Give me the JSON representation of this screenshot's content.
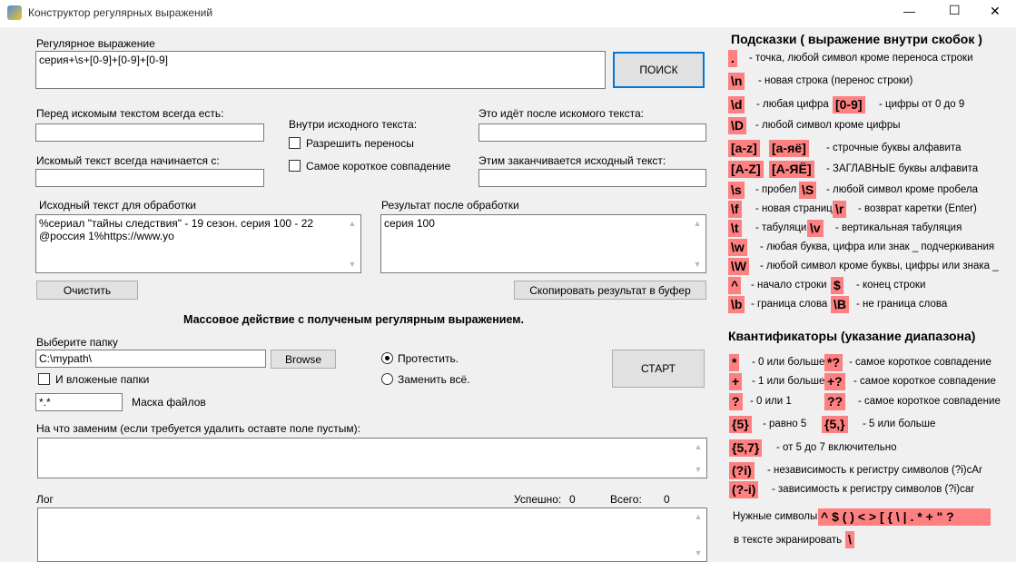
{
  "window": {
    "title": "Конструктор регулярных выражений",
    "min": "—",
    "max": "☐",
    "close": "✕"
  },
  "regex": {
    "label": "Регулярное выражение",
    "value": "серия+\\s+[0-9]+[0-9]+[0-9]",
    "search_button": "ПОИСК"
  },
  "before": {
    "label": "Перед искомым текстом всегда есть:",
    "value": ""
  },
  "starts": {
    "label": "Искомый текст всегда начинается с:",
    "value": ""
  },
  "inside": {
    "label": "Внутри исходного текста:",
    "allow_wrap": "Разрешить переносы",
    "shortest": "Самое короткое совпадение"
  },
  "after": {
    "label": "Это идёт после искомого текста:",
    "value": ""
  },
  "ends": {
    "label": "Этим заканчивается исходный текст:",
    "value": ""
  },
  "source": {
    "label": "Исходный текст для обработки",
    "value": "%сериал \"тайны следствия\" - 19 сезон. серия 100 - 22 @россия 1%https://www.yo",
    "clear_button": "Очистить"
  },
  "result": {
    "label": "Результат после обработки",
    "value": "серия 100",
    "copy_button": "Скопировать результат в буфер"
  },
  "mass": {
    "title": "Массовое действие с полученым регулярным выражением.",
    "folder_label": "Выберите папку",
    "folder_value": "C:\\mypath\\",
    "browse": "Browse",
    "subfolders": "И вложеные папки",
    "mask_value": "*.*",
    "mask_label": "Маска файлов",
    "test": "Протестить.",
    "replace_all": "Заменить всё.",
    "start": "СТАРТ",
    "replace_label": "На что заменим (если требуется удалить оставте поле пустым):",
    "log_label": "Лог",
    "success_label": "Успешно:",
    "success_value": "0",
    "total_label": "Всего:",
    "total_value": "0"
  },
  "hints": {
    "title": "Подсказки ( выражение внутри скобок )",
    "rows": [
      [
        ".",
        "- точка, любой символ кроме переноса строки"
      ],
      [
        "\\n",
        "- новая строка (перенос строки)"
      ],
      [
        "\\d",
        "- любая цифра",
        "[0-9]",
        "- цифры от 0 до 9"
      ],
      [
        "\\D",
        "- любой символ кроме цифры"
      ],
      [
        "[a-z]",
        "[а-яё]",
        "- строчные буквы алфавита"
      ],
      [
        "[A-Z]",
        "[А-ЯЁ]",
        "- ЗАГЛАВНЫЕ буквы алфавита"
      ],
      [
        "\\s",
        "- пробел",
        "\\S",
        "- любой символ кроме пробела"
      ],
      [
        "\\f",
        "- новая страница",
        "\\r",
        "- возврат каретки (Enter)"
      ],
      [
        "\\t",
        "- табуляция",
        "\\v",
        "- вертикальная табуляция"
      ],
      [
        "\\w",
        "- любая буква, цифра или знак _ подчеркивания"
      ],
      [
        "\\W",
        "- любой символ кроме буквы, цифры или знака _"
      ],
      [
        "^",
        "- начало строки",
        "$",
        "- конец строки"
      ],
      [
        "\\b",
        "- граница слова",
        "\\B",
        "- не граница слова"
      ]
    ],
    "quant_title": "Квантификаторы (указание диапазона)",
    "quant": [
      [
        "*",
        "- 0 или больше",
        "*?",
        "- самое короткое совпадение"
      ],
      [
        "+",
        "- 1 или больше",
        "+?",
        "- самое короткое совпадение"
      ],
      [
        "?",
        "- 0 или 1",
        "??",
        "- самое короткое совпадение"
      ],
      [
        "{5}",
        "- равно 5",
        "{5,}",
        "- 5 или больше"
      ],
      [
        "{5,7}",
        "- от 5 до 7 включительно"
      ],
      [
        "(?i)",
        "- независимость к регистру символов (?i)cAr"
      ],
      [
        "(?-i)",
        "- зависимость к регистру символов (?i)car"
      ]
    ],
    "needed_label": "Нужные символы",
    "needed": "^ $ ( ) < > [ { \\ |  . * + \"  ?",
    "escape_label": "в тексте экранировать",
    "escape": "\\"
  }
}
